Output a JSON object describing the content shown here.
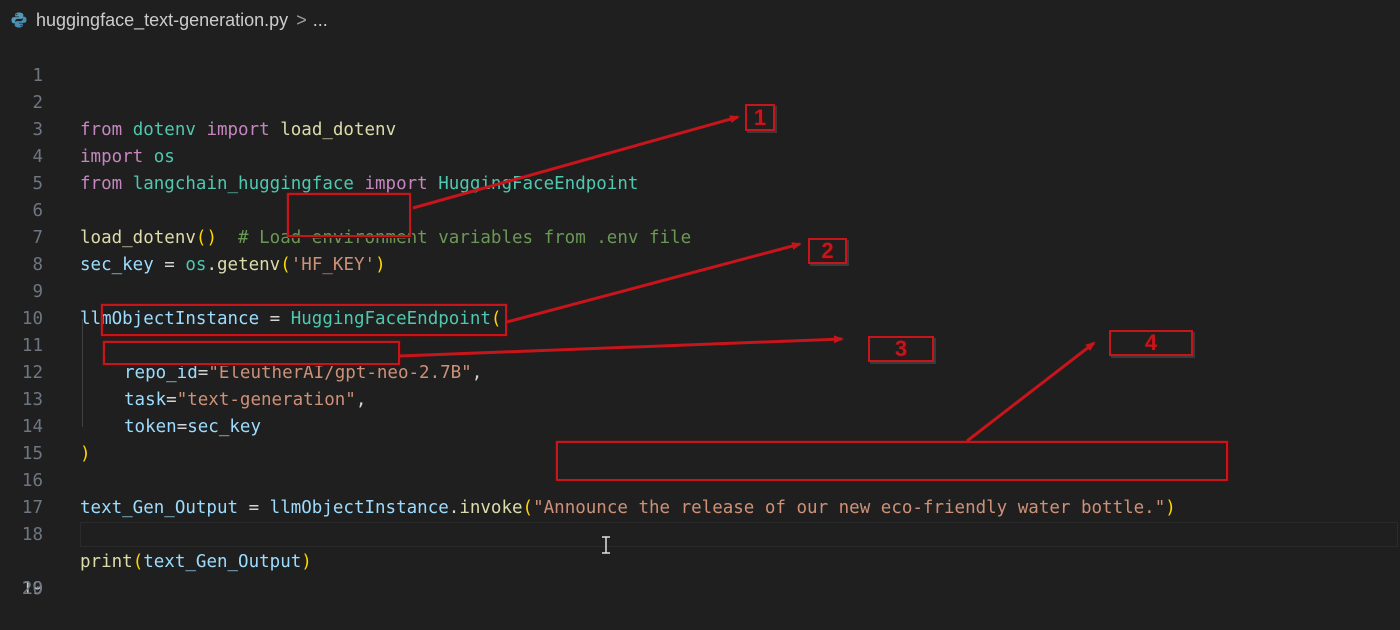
{
  "breadcrumb": {
    "file_name": "huggingface_text-generation.py",
    "separator": ">",
    "more": "..."
  },
  "editor": {
    "line_numbers": [
      "1",
      "2",
      "3",
      "4",
      "5",
      "6",
      "7",
      "8",
      "9",
      "10",
      "11",
      "12",
      "13",
      "14",
      "15",
      "16",
      "17",
      "18",
      "19",
      "20"
    ],
    "active_line": "19",
    "lines": {
      "l2": {
        "t1": "from",
        "t2": " dotenv ",
        "t3": "import",
        "t4": " load_dotenv"
      },
      "l3": {
        "t1": "import",
        "t2": " os"
      },
      "l4": {
        "t1": "from",
        "t2": " langchain_huggingface ",
        "t3": "import",
        "t4": " HuggingFaceEndpoint"
      },
      "l6": {
        "t1": "load_dotenv",
        "t2": "()",
        "t3": "  # Load environment variables from .env file"
      },
      "l7": {
        "t1": "sec_key",
        "t2": " = ",
        "t3": "os",
        "t4": ".",
        "t5": "getenv",
        "t6": "(",
        "t7": "'HF_KEY'",
        "t8": ")"
      },
      "l9": {
        "t1": "llmObjectInstance",
        "t2": " = ",
        "t3": "HuggingFaceEndpoint",
        "t4": "("
      },
      "l11": {
        "t1": "repo_id",
        "t2": "=",
        "t3": "\"EleutherAI/gpt-neo-2.7B\"",
        "t4": ","
      },
      "l12": {
        "t1": "task",
        "t2": "=",
        "t3": "\"text-generation\"",
        "t4": ","
      },
      "l13": {
        "t1": "token",
        "t2": "=",
        "t3": "sec_key"
      },
      "l14": {
        "t1": ")"
      },
      "l16": {
        "t1": "text_Gen_Output",
        "t2": " = ",
        "t3": "llmObjectInstance",
        "t4": ".",
        "t5": "invoke",
        "t6": "(",
        "t7": "\"Announce the release of our new eco-friendly water bottle.\"",
        "t8": ")"
      },
      "l18": {
        "t1": "print",
        "t2": "(",
        "t3": "text_Gen_Output",
        "t4": ")"
      }
    }
  },
  "annotations": {
    "labels": [
      "1",
      "2",
      "3",
      "4"
    ],
    "color": "#c8141b"
  },
  "colors": {
    "background": "#1f1f1f",
    "keyword": "#c586c0",
    "module": "#4ec9b0",
    "function": "#dcdcaa",
    "variable": "#9cdcfe",
    "string": "#ce9178",
    "comment": "#6a9955",
    "bracket": "#ffd700",
    "line_number": "#6e7681"
  },
  "icons": {
    "file": "python-file-icon",
    "cursor": "text-cursor-icon"
  }
}
